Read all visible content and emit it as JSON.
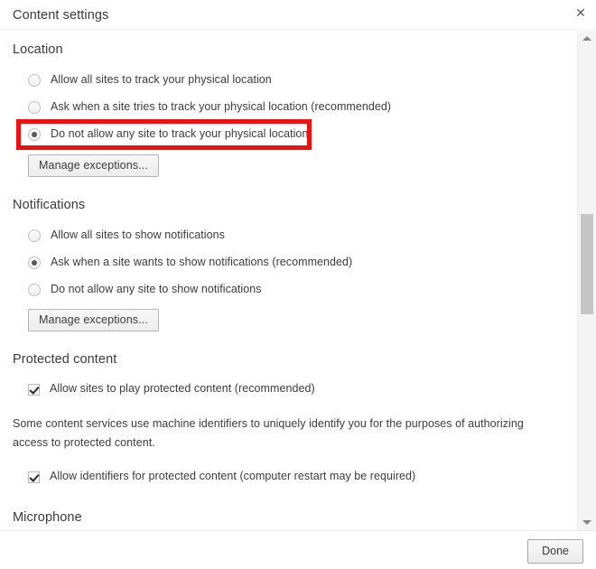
{
  "dialog": {
    "title": "Content settings",
    "close_icon": "close-icon"
  },
  "sections": {
    "location": {
      "heading": "Location",
      "options": [
        {
          "label": "Allow all sites to track your physical location",
          "checked": false
        },
        {
          "label": "Ask when a site tries to track your physical location (recommended)",
          "checked": false
        },
        {
          "label": "Do not allow any site to track your physical location",
          "checked": true
        }
      ],
      "manage_button": "Manage exceptions..."
    },
    "notifications": {
      "heading": "Notifications",
      "options": [
        {
          "label": "Allow all sites to show notifications",
          "checked": false
        },
        {
          "label": "Ask when a site wants to show notifications (recommended)",
          "checked": true
        },
        {
          "label": "Do not allow any site to show notifications",
          "checked": false
        }
      ],
      "manage_button": "Manage exceptions..."
    },
    "protected_content": {
      "heading": "Protected content",
      "allow_play_label": "Allow sites to play protected content (recommended)",
      "allow_play_checked": true,
      "description": "Some content services use machine identifiers to uniquely identify you for the purposes of authorizing access to protected content.",
      "allow_identifiers_label": "Allow identifiers for protected content (computer restart may be required)",
      "allow_identifiers_checked": true
    },
    "microphone": {
      "heading": "Microphone"
    }
  },
  "annotation": {
    "color": "#ee1111",
    "target": "Do not allow any site to track your physical location"
  },
  "scrollbar": {
    "up_arrow_icon": "triangle-up-icon",
    "down_arrow_icon": "triangle-down-icon"
  },
  "footer": {
    "done_label": "Done"
  }
}
